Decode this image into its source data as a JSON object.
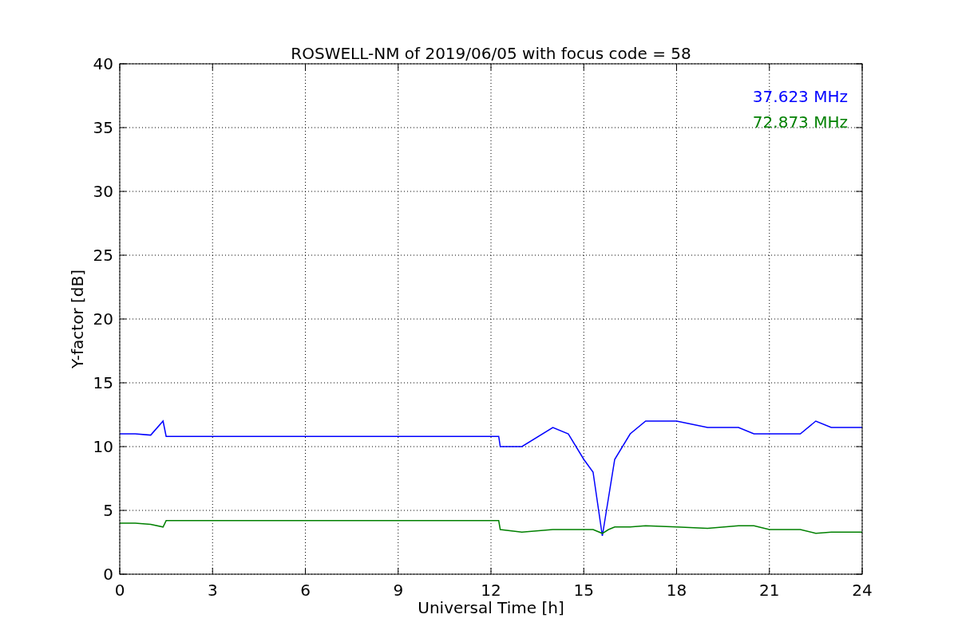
{
  "chart_data": {
    "type": "line",
    "title": "ROSWELL-NM of 2019/06/05 with focus code = 58",
    "xlabel": "Universal Time [h]",
    "ylabel": "Y-factor [dB]",
    "x": [
      0,
      0.5,
      1,
      1.4,
      1.5,
      12.25,
      12.3,
      13,
      14,
      14.5,
      15,
      15.3,
      15.6,
      15.8,
      16,
      16.5,
      17,
      18,
      19,
      20,
      20.5,
      21,
      22,
      22.5,
      23,
      24
    ],
    "series": [
      {
        "name": "37.623 MHz",
        "color": "#0000ff",
        "values": [
          11,
          11,
          10.9,
          12,
          10.8,
          10.8,
          10,
          10,
          11.5,
          11,
          9,
          8,
          3,
          6,
          9,
          11,
          12,
          12,
          11.5,
          11.5,
          11,
          11,
          11,
          12,
          11.5,
          11.5
        ]
      },
      {
        "name": "72.873 MHz",
        "color": "#008000",
        "values": [
          4,
          4,
          3.9,
          3.7,
          4.2,
          4.2,
          3.5,
          3.3,
          3.5,
          3.5,
          3.5,
          3.5,
          3.2,
          3.5,
          3.7,
          3.7,
          3.8,
          3.7,
          3.6,
          3.8,
          3.8,
          3.5,
          3.5,
          3.2,
          3.3,
          3.3
        ]
      }
    ],
    "grid": true,
    "xlim": [
      0,
      24
    ],
    "ylim": [
      0,
      40
    ],
    "xticks": [
      0,
      3,
      6,
      9,
      12,
      15,
      18,
      21,
      24
    ],
    "yticks": [
      0,
      5,
      10,
      15,
      20,
      25,
      30,
      35,
      40
    ]
  }
}
